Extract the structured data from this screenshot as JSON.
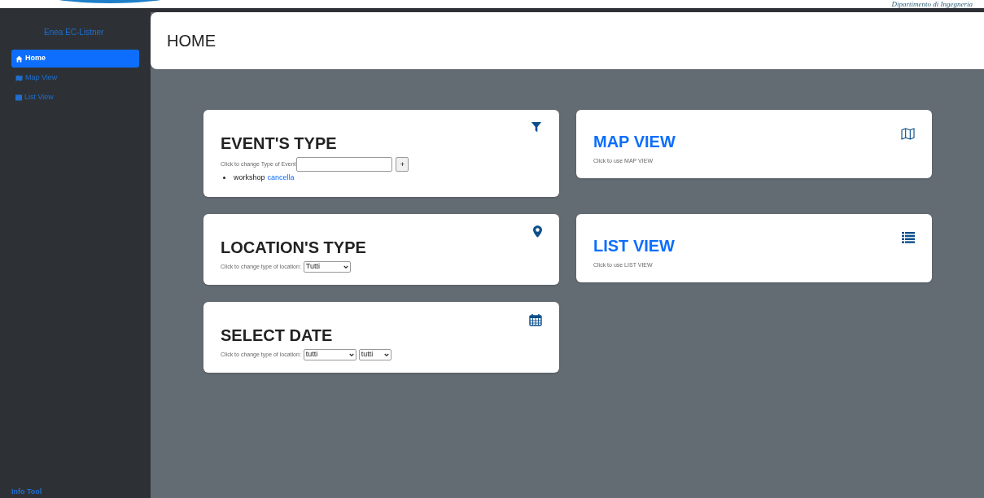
{
  "top_banner": {
    "text": "Dipartimento di Ingegneria"
  },
  "sidebar": {
    "brand": "Enea EC-Listner",
    "items": [
      {
        "label": "Home",
        "selected": true
      },
      {
        "label": "Map View",
        "selected": false
      },
      {
        "label": "List View",
        "selected": false
      }
    ],
    "footer": "Info Tool"
  },
  "header": {
    "title": "HOME"
  },
  "left_cards": [
    {
      "kind": "event_type",
      "title": "EVENT'S TYPE",
      "label": "Click to change Type of Event",
      "button": "+",
      "items": [
        {
          "text": "workshop",
          "action": "cancella"
        }
      ]
    },
    {
      "kind": "select",
      "title": "LOCATION'S TYPE",
      "label": "Click to change type of location:",
      "selects": [
        "Tutti"
      ]
    },
    {
      "kind": "select",
      "title": "SELECT DATE",
      "label": "Click to change type of location:",
      "selects": [
        "tutti",
        "tutti"
      ]
    }
  ],
  "right_cards": [
    {
      "title": "MAP VIEW",
      "subtitle": "Click to use MAP VIEW"
    },
    {
      "title": "LIST VIEW",
      "subtitle": "Click to use LIST VIEW"
    }
  ]
}
